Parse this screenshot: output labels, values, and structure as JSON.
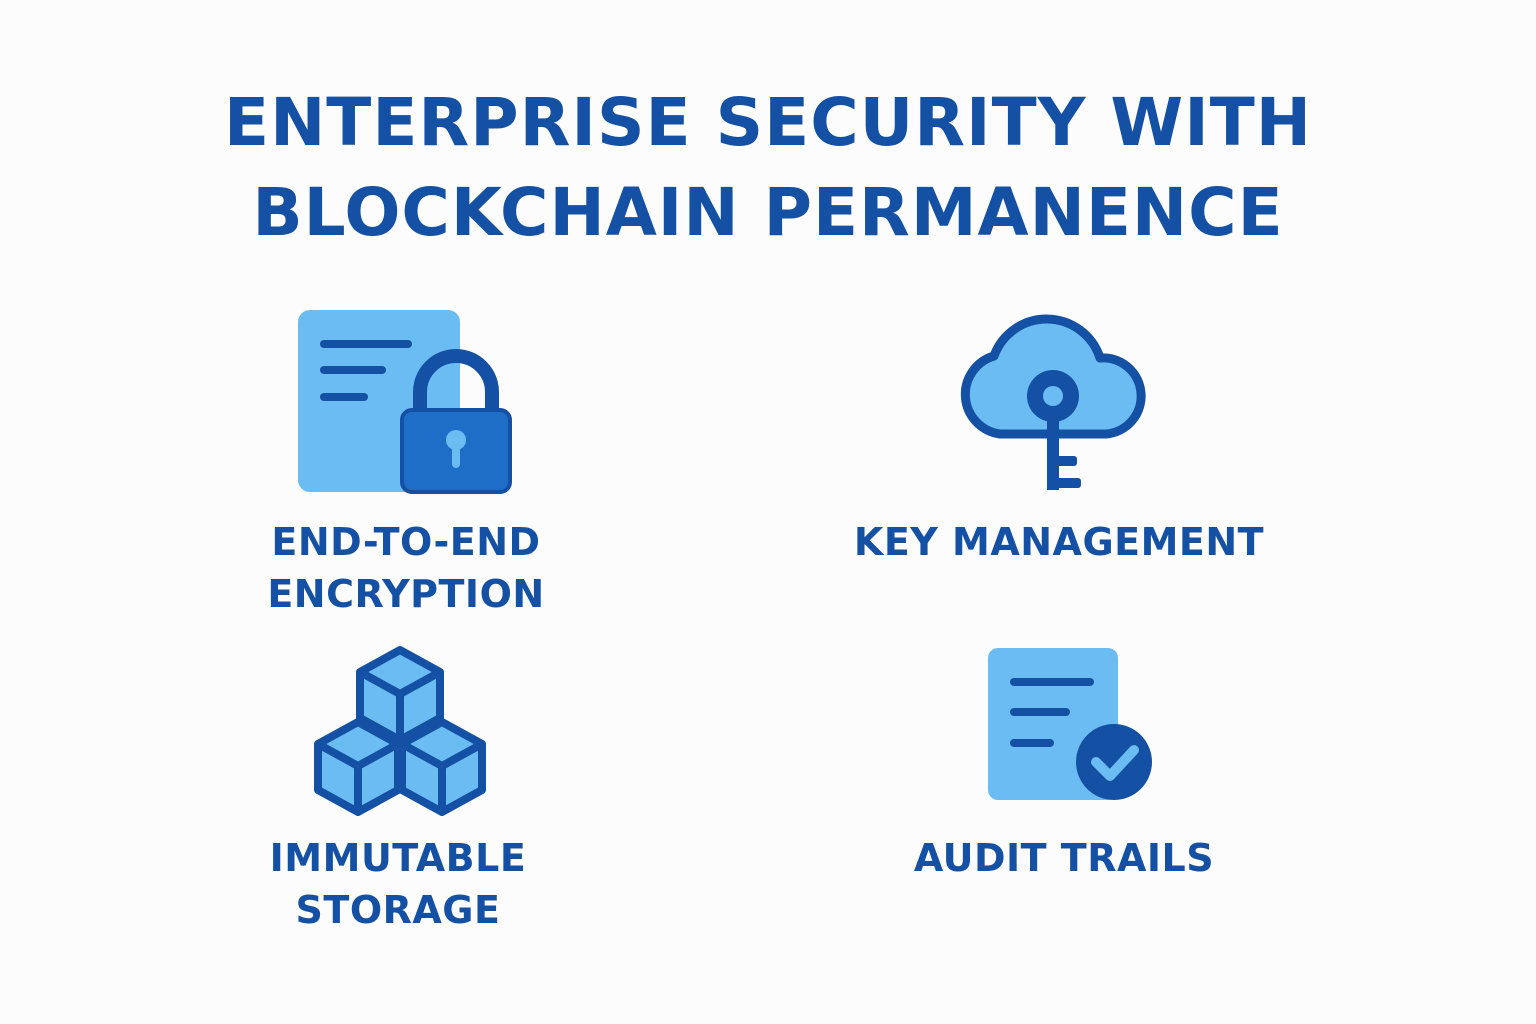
{
  "title": {
    "line1": "ENTERPRISE SECURITY WITH",
    "line2": "BLOCKCHAIN PERMANENCE"
  },
  "features": [
    {
      "icon": "document-lock-icon",
      "label_lines": [
        "END-TO-END",
        "ENCRYPTION"
      ]
    },
    {
      "icon": "cloud-key-icon",
      "label_lines": [
        "KEY MANAGEMENT"
      ]
    },
    {
      "icon": "stacked-cubes-icon",
      "label_lines": [
        "IMMUTABLE",
        "STORAGE"
      ]
    },
    {
      "icon": "document-check-icon",
      "label_lines": [
        "AUDIT TRAILS"
      ]
    }
  ],
  "colors": {
    "dark_blue": "#1450a3",
    "light_blue": "#6bbcf2",
    "mid_blue": "#1e6ec8",
    "background": "#fcfcfc"
  }
}
